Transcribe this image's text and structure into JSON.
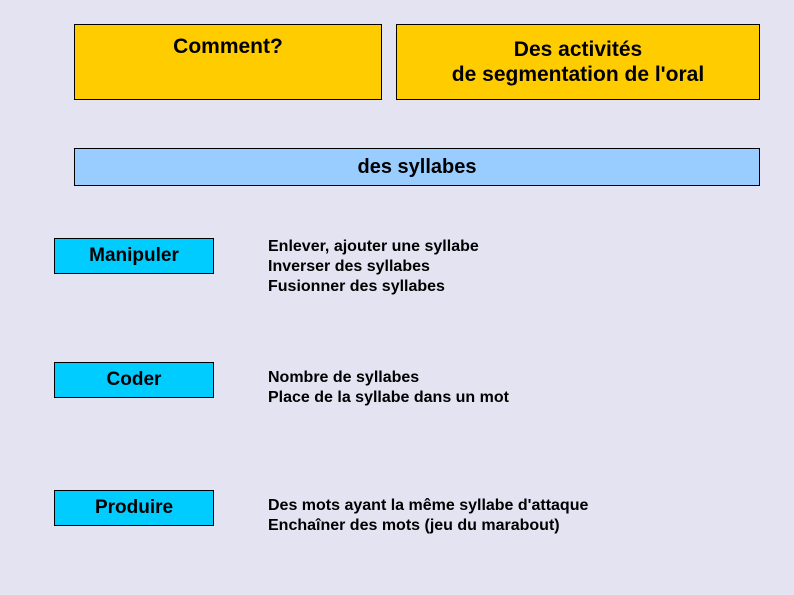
{
  "header": {
    "comment": "Comment?",
    "activities_line1": "Des activités",
    "activities_line2": "de segmentation de l'oral"
  },
  "subtitle": "des syllabes",
  "rows": [
    {
      "label": "Manipuler",
      "desc_line1": "Enlever, ajouter une syllabe",
      "desc_line2": "Inverser des syllabes",
      "desc_line3": "Fusionner des syllabes"
    },
    {
      "label": "Coder",
      "desc_line1": "Nombre de syllabes",
      "desc_line2": "Place de la syllabe dans un mot",
      "desc_line3": ""
    },
    {
      "label": "Produire",
      "desc_line1": "Des mots ayant la même syllabe d'attaque",
      "desc_line2": "Enchaîner des mots (jeu du marabout)",
      "desc_line3": ""
    }
  ]
}
